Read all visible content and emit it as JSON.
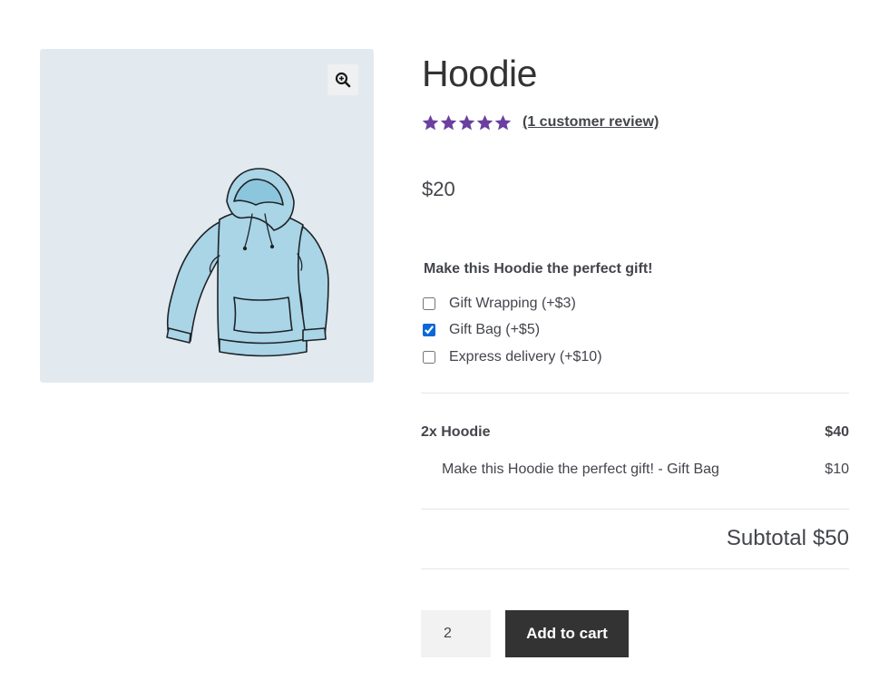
{
  "product": {
    "title": "Hoodie",
    "rating": 5,
    "rating_max": 5,
    "review_link": "(1 customer review)",
    "price": "$20",
    "image_icon": "hoodie-illustration",
    "zoom_icon": "zoom-in-icon"
  },
  "addons": {
    "heading": "Make this Hoodie the perfect gift!",
    "options": [
      {
        "label": "Gift Wrapping (+$3)",
        "checked": false
      },
      {
        "label": "Gift Bag (+$5)",
        "checked": true
      },
      {
        "label": "Express delivery (+$10)",
        "checked": false
      }
    ]
  },
  "summary": {
    "main_item": {
      "label": "2x Hoodie",
      "amount": "$40"
    },
    "addon_item": {
      "label": "Make this Hoodie the perfect gift! - Gift Bag",
      "amount": "$10"
    },
    "subtotal_label": "Subtotal",
    "subtotal_value": "$50"
  },
  "cart": {
    "quantity": "2",
    "add_label": "Add to cart"
  },
  "colors": {
    "star": "#6b3fa0",
    "button": "#333333",
    "gallery_bg": "#e3eaef",
    "checkbox": "#0a68d8"
  }
}
